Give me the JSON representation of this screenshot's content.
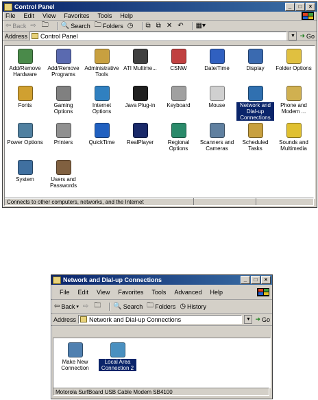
{
  "window1": {
    "title": "Control Panel",
    "menu": [
      "File",
      "Edit",
      "View",
      "Favorites",
      "Tools",
      "Help"
    ],
    "toolbar": {
      "back": "Back",
      "search": "Search",
      "folders": "Folders"
    },
    "address_label": "Address",
    "address_value": "Control Panel",
    "go": "Go",
    "items": [
      {
        "label": "Add/Remove Hardware",
        "icon": "hardware-icon",
        "color": "#4a8a4a"
      },
      {
        "label": "Add/Remove Programs",
        "icon": "programs-icon",
        "color": "#5a6ab0"
      },
      {
        "label": "Administrative Tools",
        "icon": "tools-icon",
        "color": "#c8a040"
      },
      {
        "label": "ATI Multime...",
        "icon": "ati-icon",
        "color": "#404040"
      },
      {
        "label": "CSNW",
        "icon": "csnw-icon",
        "color": "#c04040"
      },
      {
        "label": "Date/Time",
        "icon": "clock-icon",
        "color": "#3060c0"
      },
      {
        "label": "Display",
        "icon": "monitor-icon",
        "color": "#3a6ab0"
      },
      {
        "label": "Folder Options",
        "icon": "folder-icon",
        "color": "#e0c040"
      },
      {
        "label": "Fonts",
        "icon": "fonts-icon",
        "color": "#d0a030"
      },
      {
        "label": "Gaming Options",
        "icon": "joystick-icon",
        "color": "#808080"
      },
      {
        "label": "Internet Options",
        "icon": "globe-icon",
        "color": "#3080c0"
      },
      {
        "label": "Java Plug-in",
        "icon": "java-icon",
        "color": "#202020"
      },
      {
        "label": "Keyboard",
        "icon": "keyboard-icon",
        "color": "#a0a0a0"
      },
      {
        "label": "Mouse",
        "icon": "mouse-icon",
        "color": "#d0d0d0"
      },
      {
        "label": "Network and Dial-up Connections",
        "icon": "network-icon",
        "color": "#3070b0",
        "selected": true
      },
      {
        "label": "Phone and Modem ...",
        "icon": "phone-icon",
        "color": "#d0b050"
      },
      {
        "label": "Power Options",
        "icon": "power-icon",
        "color": "#5080a0"
      },
      {
        "label": "Printers",
        "icon": "printer-icon",
        "color": "#909090"
      },
      {
        "label": "QuickTime",
        "icon": "quicktime-icon",
        "color": "#2060c0"
      },
      {
        "label": "RealPlayer",
        "icon": "realplayer-icon",
        "color": "#1a2a6a"
      },
      {
        "label": "Regional Options",
        "icon": "globe-icon",
        "color": "#2a8a6a"
      },
      {
        "label": "Scanners and Cameras",
        "icon": "scanner-icon",
        "color": "#6080a0"
      },
      {
        "label": "Scheduled Tasks",
        "icon": "tasks-icon",
        "color": "#c8a040"
      },
      {
        "label": "Sounds and Multimedia",
        "icon": "speaker-icon",
        "color": "#e0c030"
      },
      {
        "label": "System",
        "icon": "computer-icon",
        "color": "#4070a0"
      },
      {
        "label": "Users and Passwords",
        "icon": "users-icon",
        "color": "#806040"
      }
    ],
    "status": "Connects to other computers, networks, and the Internet"
  },
  "window2": {
    "title": "Network and Dial-up Connections",
    "menu": [
      "File",
      "Edit",
      "View",
      "Favorites",
      "Tools",
      "Advanced",
      "Help"
    ],
    "toolbar": {
      "back": "Back",
      "search": "Search",
      "folders": "Folders",
      "history": "History"
    },
    "address_label": "Address",
    "address_value": "Network and Dial-up Connections",
    "go": "Go",
    "items": [
      {
        "label": "Make New Connection",
        "icon": "new-connection-icon",
        "color": "#5080b0"
      },
      {
        "label": "Local Area Connection 2",
        "icon": "lan-icon",
        "color": "#4a90c0",
        "selected": true
      }
    ],
    "status": "Motorola SurfBoard USB Cable Modem SB4100"
  }
}
